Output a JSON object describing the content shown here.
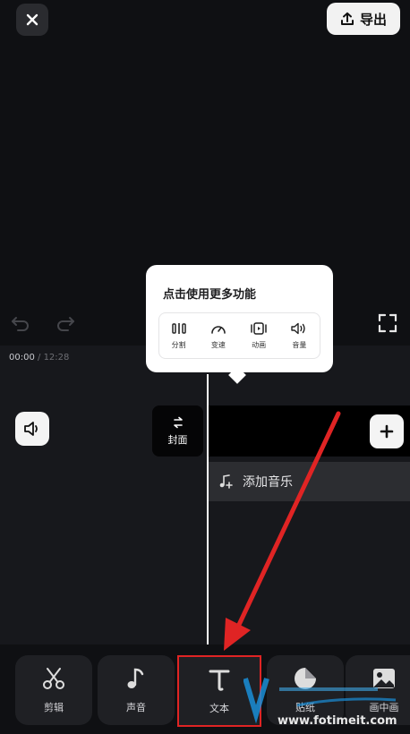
{
  "header": {
    "close_icon": "close-icon",
    "export_label": "导出",
    "export_icon": "upload-icon"
  },
  "player": {
    "current_time": "00:00",
    "separator": " / ",
    "total_time": "12:28"
  },
  "timeline": {
    "cover_label": "封面",
    "add_music_label": "添加音乐"
  },
  "popup": {
    "title": "点击使用更多功能",
    "items": [
      {
        "label": "分割",
        "icon": "split-icon"
      },
      {
        "label": "变速",
        "icon": "speed-icon"
      },
      {
        "label": "动画",
        "icon": "animation-icon"
      },
      {
        "label": "音量",
        "icon": "volume-icon"
      }
    ]
  },
  "toolbar": {
    "items": [
      {
        "label": "剪辑",
        "icon": "scissors-icon"
      },
      {
        "label": "声音",
        "icon": "music-note-icon"
      },
      {
        "label": "文本",
        "icon": "text-icon"
      },
      {
        "label": "贴纸",
        "icon": "sticker-icon"
      },
      {
        "label": "画中画",
        "icon": "picture-in-picture-icon"
      }
    ]
  },
  "watermark": {
    "text": "www.fotimeit.com"
  },
  "colors": {
    "background": "#0f1013",
    "accent_red": "#e02424",
    "popup_bg": "#ffffff"
  }
}
